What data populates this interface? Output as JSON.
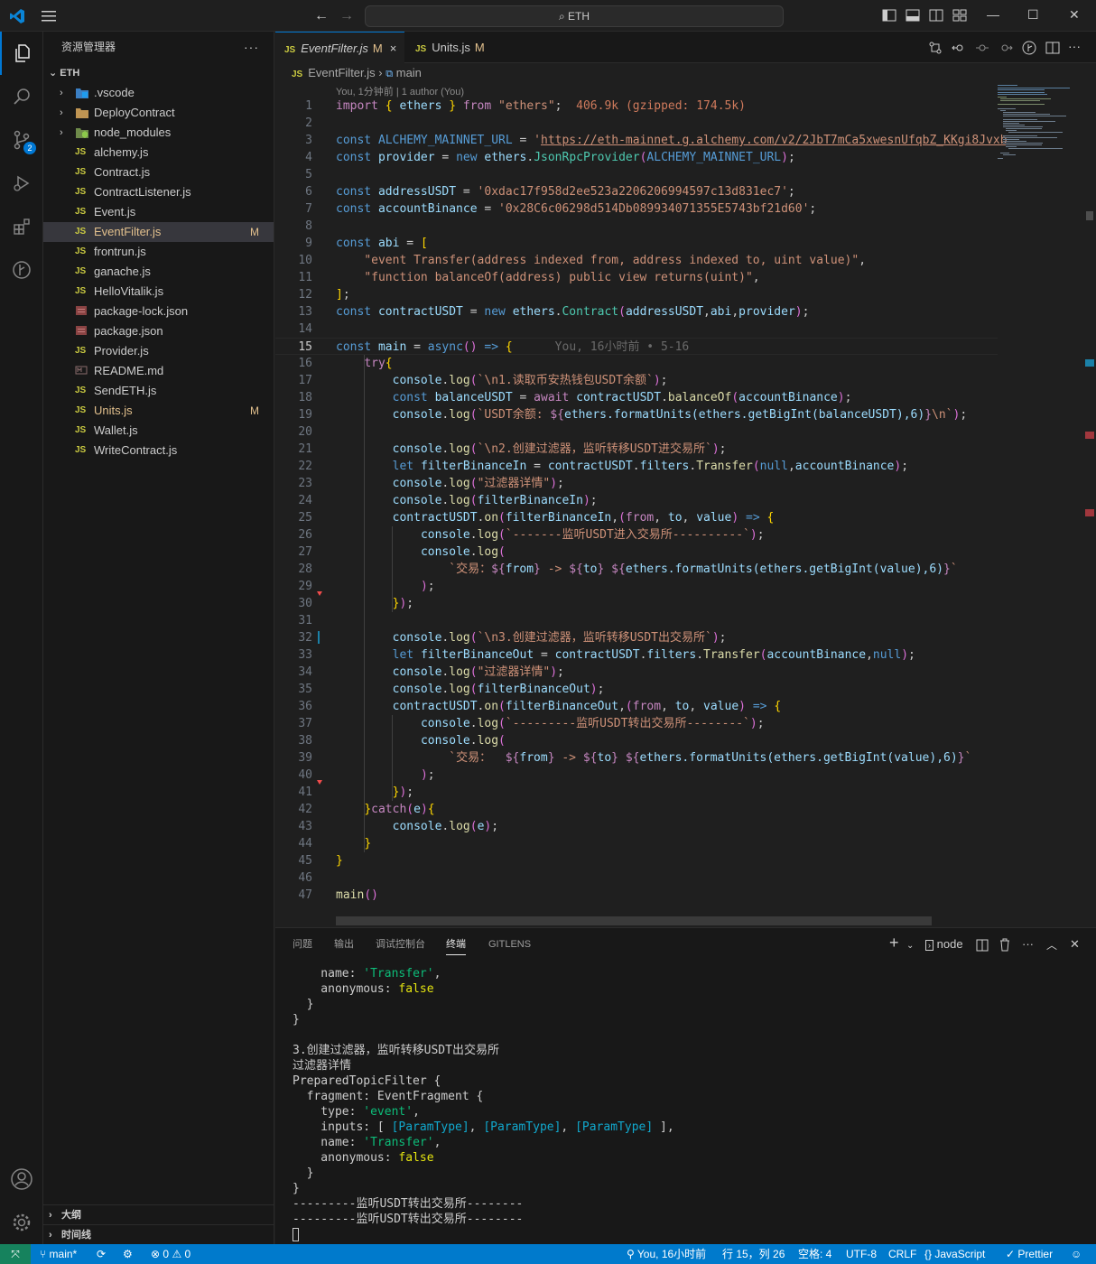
{
  "titlebar": {
    "search_text": "ETH"
  },
  "activity": {
    "scm_badge": "2"
  },
  "sidebar": {
    "title": "资源管理器",
    "more": "···",
    "root": "ETH",
    "items": [
      {
        "name": ".vscode",
        "type": "folder-vscode",
        "chevron": "›"
      },
      {
        "name": "DeployContract",
        "type": "folder",
        "chevron": "›"
      },
      {
        "name": "node_modules",
        "type": "folder-node",
        "chevron": "›"
      },
      {
        "name": "alchemy.js",
        "type": "js"
      },
      {
        "name": "Contract.js",
        "type": "js"
      },
      {
        "name": "ContractListener.js",
        "type": "js"
      },
      {
        "name": "Event.js",
        "type": "js"
      },
      {
        "name": "EventFilter.js",
        "type": "js",
        "status": "M",
        "selected": true
      },
      {
        "name": "frontrun.js",
        "type": "js"
      },
      {
        "name": "ganache.js",
        "type": "js"
      },
      {
        "name": "HelloVitalik.js",
        "type": "js"
      },
      {
        "name": "package-lock.json",
        "type": "json"
      },
      {
        "name": "package.json",
        "type": "json"
      },
      {
        "name": "Provider.js",
        "type": "js"
      },
      {
        "name": "README.md",
        "type": "md"
      },
      {
        "name": "SendETH.js",
        "type": "js"
      },
      {
        "name": "Units.js",
        "type": "js",
        "status": "M"
      },
      {
        "name": "Wallet.js",
        "type": "js"
      },
      {
        "name": "WriteContract.js",
        "type": "js"
      }
    ],
    "outline": "大纲",
    "timeline": "时间线"
  },
  "tabs": [
    {
      "icon": "JS",
      "name": "EventFilter.js",
      "modified": "M",
      "close": "×"
    },
    {
      "icon": "JS",
      "name": "Units.js",
      "modified": "M"
    }
  ],
  "breadcrumb": {
    "icon": "JS",
    "file": "EventFilter.js",
    "sep": "›",
    "symbol": "main"
  },
  "editor": {
    "blame_top": "You, 1分钟前 | 1 author (You)",
    "current_line": 15,
    "lines": [
      "import { ethers } from \"ethers\";  406.9k (gzipped: 174.5k)",
      "",
      "const ALCHEMY_MAINNET_URL = 'https://eth-mainnet.g.alchemy.com/v2/2JbT7mCa5xwesnUfqbZ_KKgi8Jvxb",
      "const provider = new ethers.JsonRpcProvider(ALCHEMY_MAINNET_URL);",
      "",
      "const addressUSDT = '0xdac17f958d2ee523a2206206994597c13d831ec7';",
      "const accountBinance = '0x28C6c06298d514Db089934071355E5743bf21d60';",
      "",
      "const abi = [",
      "    \"event Transfer(address indexed from, address indexed to, uint value)\",",
      "    \"function balanceOf(address) public view returns(uint)\",",
      "];",
      "const contractUSDT = new ethers.Contract(addressUSDT,abi,provider);",
      "",
      "const main = async() => {      You, 16小时前 • 5-16",
      "    try{",
      "        console.log(`\\n1.读取币安热钱包USDT余额`);",
      "        const balanceUSDT = await contractUSDT.balanceOf(accountBinance);",
      "        console.log(`USDT余额: ${ethers.formatUnits(ethers.getBigInt(balanceUSDT),6)}\\n`);",
      "",
      "        console.log(`\\n2.创建过滤器，监听转移USDT进交易所`);",
      "        let filterBinanceIn = contractUSDT.filters.Transfer(null,accountBinance);",
      "        console.log(\"过滤器详情\");",
      "        console.log(filterBinanceIn);",
      "        contractUSDT.on(filterBinanceIn,(from, to, value) => {",
      "            console.log(`-------监听USDT进入交易所----------`);",
      "            console.log(",
      "                `交易：${from} -> ${to} ${ethers.formatUnits(ethers.getBigInt(value),6)}`",
      "            );",
      "        });",
      "",
      "        console.log(`\\n3.创建过滤器，监听转移USDT出交易所`);",
      "        let filterBinanceOut = contractUSDT.filters.Transfer(accountBinance,null);",
      "        console.log(\"过滤器详情\");",
      "        console.log(filterBinanceOut);",
      "        contractUSDT.on(filterBinanceOut,(from, to, value) => {",
      "            console.log(`---------监听USDT转出交易所--------`);",
      "            console.log(",
      "                `交易：  ${from} -> ${to} ${ethers.formatUnits(ethers.getBigInt(value),6)}`",
      "            );",
      "        });",
      "    }catch(e){",
      "        console.log(e);",
      "    }",
      "}",
      "",
      "main()"
    ]
  },
  "panel": {
    "tabs": [
      "问题",
      "输出",
      "调试控制台",
      "终端",
      "GITLENS"
    ],
    "active_tab": "终端",
    "terminal_name": "node",
    "lines": [
      "    name: 'Transfer',",
      "    anonymous: false",
      "  }",
      "}",
      "",
      "3.创建过滤器，监听转移USDT出交易所",
      "过滤器详情",
      "PreparedTopicFilter {",
      "  fragment: EventFragment {",
      "    type: 'event',",
      "    inputs: [ [ParamType], [ParamType], [ParamType] ],",
      "    name: 'Transfer',",
      "    anonymous: false",
      "  }",
      "}",
      "---------监听USDT转出交易所--------",
      "---------监听USDT转出交易所--------"
    ]
  },
  "statusbar": {
    "branch": "main*",
    "errors": "0",
    "warnings": "0",
    "blame": "You, 16小时前",
    "position": "行 15，列 26",
    "spaces": "空格: 4",
    "encoding": "UTF-8",
    "eol": "CRLF",
    "language": "JavaScript",
    "formatter": "Prettier"
  },
  "colors": {
    "accent": "#0078d4",
    "statusbar": "#007acc",
    "remote": "#16825d",
    "modified": "#e2c08d",
    "js_icon": "#cbcb41"
  }
}
